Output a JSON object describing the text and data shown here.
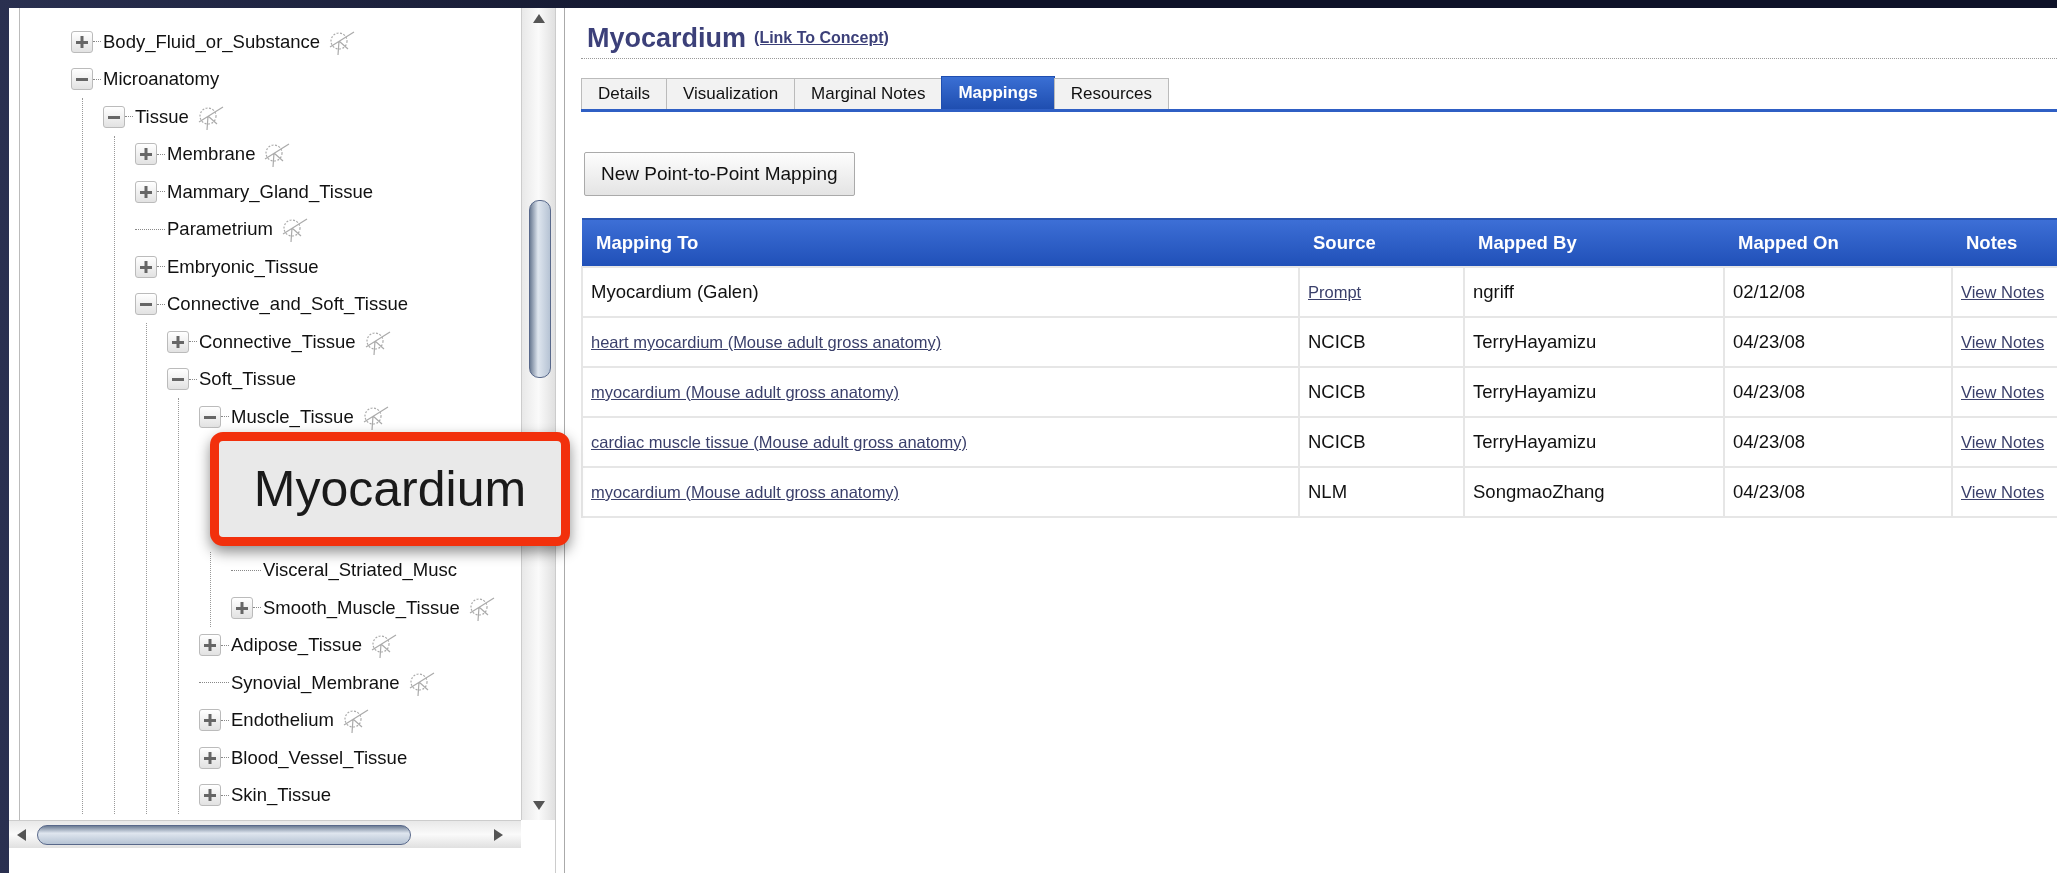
{
  "tree": [
    {
      "label": "Body_Fluid_or_Substance",
      "kind": "branch",
      "expanded": false,
      "has_icon": true
    },
    {
      "label": "Microanatomy",
      "kind": "branch",
      "expanded": true,
      "has_icon": false,
      "children": [
        {
          "label": "Tissue",
          "kind": "branch",
          "expanded": true,
          "has_icon": true,
          "children": [
            {
              "label": "Membrane",
              "kind": "branch",
              "expanded": false,
              "has_icon": true
            },
            {
              "label": "Mammary_Gland_Tissue",
              "kind": "branch",
              "expanded": false,
              "has_icon": false
            },
            {
              "label": "Parametrium",
              "kind": "leaf",
              "has_icon": true
            },
            {
              "label": "Embryonic_Tissue",
              "kind": "branch",
              "expanded": false,
              "has_icon": false
            },
            {
              "label": "Connective_and_Soft_Tissue",
              "kind": "branch",
              "expanded": true,
              "has_icon": false,
              "children": [
                {
                  "label": "Connective_Tissue",
                  "kind": "branch",
                  "expanded": false,
                  "has_icon": true
                },
                {
                  "label": "Soft_Tissue",
                  "kind": "branch",
                  "expanded": true,
                  "has_icon": false,
                  "children": [
                    {
                      "label": "Muscle_Tissue",
                      "kind": "branch",
                      "expanded": true,
                      "has_icon": true,
                      "children": [
                        {
                          "label": "Visceral_Striated_Musc",
                          "kind": "leaf",
                          "has_icon": false
                        },
                        {
                          "label": "Smooth_Muscle_Tissue",
                          "kind": "branch",
                          "expanded": false,
                          "has_icon": true
                        }
                      ]
                    },
                    {
                      "label": "Adipose_Tissue",
                      "kind": "branch",
                      "expanded": false,
                      "has_icon": true
                    },
                    {
                      "label": "Synovial_Membrane",
                      "kind": "leaf",
                      "has_icon": true
                    },
                    {
                      "label": "Endothelium",
                      "kind": "branch",
                      "expanded": false,
                      "has_icon": true
                    },
                    {
                      "label": "Blood_Vessel_Tissue",
                      "kind": "branch",
                      "expanded": false,
                      "has_icon": false
                    },
                    {
                      "label": "Skin_Tissue",
                      "kind": "branch",
                      "expanded": false,
                      "has_icon": false
                    }
                  ]
                }
              ]
            }
          ]
        }
      ]
    }
  ],
  "callout": {
    "text": "Myocardium"
  },
  "concept": {
    "title": "Myocardium",
    "link": "(Link To Concept)"
  },
  "tabs": [
    {
      "label": "Details",
      "selected": false
    },
    {
      "label": "Visualization",
      "selected": false
    },
    {
      "label": "Marginal Notes",
      "selected": false
    },
    {
      "label": "Mappings",
      "selected": true
    },
    {
      "label": "Resources",
      "selected": false
    }
  ],
  "action_button": "New Point-to-Point Mapping",
  "table": {
    "columns": [
      "Mapping To",
      "Source",
      "Mapped By",
      "Mapped On",
      "Notes"
    ],
    "rows": [
      [
        {
          "text": "Myocardium (Galen)",
          "link": false
        },
        {
          "text": "Prompt",
          "link": true
        },
        {
          "text": "ngriff",
          "link": false
        },
        {
          "text": "02/12/08",
          "link": false
        },
        {
          "text": "View Notes",
          "link": true
        }
      ],
      [
        {
          "text": "heart myocardium (Mouse adult gross anatomy)",
          "link": true
        },
        {
          "text": "NCICB",
          "link": false
        },
        {
          "text": "TerryHayamizu",
          "link": false
        },
        {
          "text": "04/23/08",
          "link": false
        },
        {
          "text": "View Notes",
          "link": true
        }
      ],
      [
        {
          "text": "myocardium (Mouse adult gross anatomy)",
          "link": true
        },
        {
          "text": "NCICB",
          "link": false
        },
        {
          "text": "TerryHayamizu",
          "link": false
        },
        {
          "text": "04/23/08",
          "link": false
        },
        {
          "text": "View Notes",
          "link": true
        }
      ],
      [
        {
          "text": "cardiac muscle tissue (Mouse adult gross anatomy)",
          "link": true
        },
        {
          "text": "NCICB",
          "link": false
        },
        {
          "text": "TerryHayamizu",
          "link": false
        },
        {
          "text": "04/23/08",
          "link": false
        },
        {
          "text": "View Notes",
          "link": true
        }
      ],
      [
        {
          "text": "myocardium (Mouse adult gross anatomy)",
          "link": true
        },
        {
          "text": "NLM",
          "link": false
        },
        {
          "text": "SongmaoZhang",
          "link": false
        },
        {
          "text": "04/23/08",
          "link": false
        },
        {
          "text": "View Notes",
          "link": true
        }
      ]
    ]
  }
}
